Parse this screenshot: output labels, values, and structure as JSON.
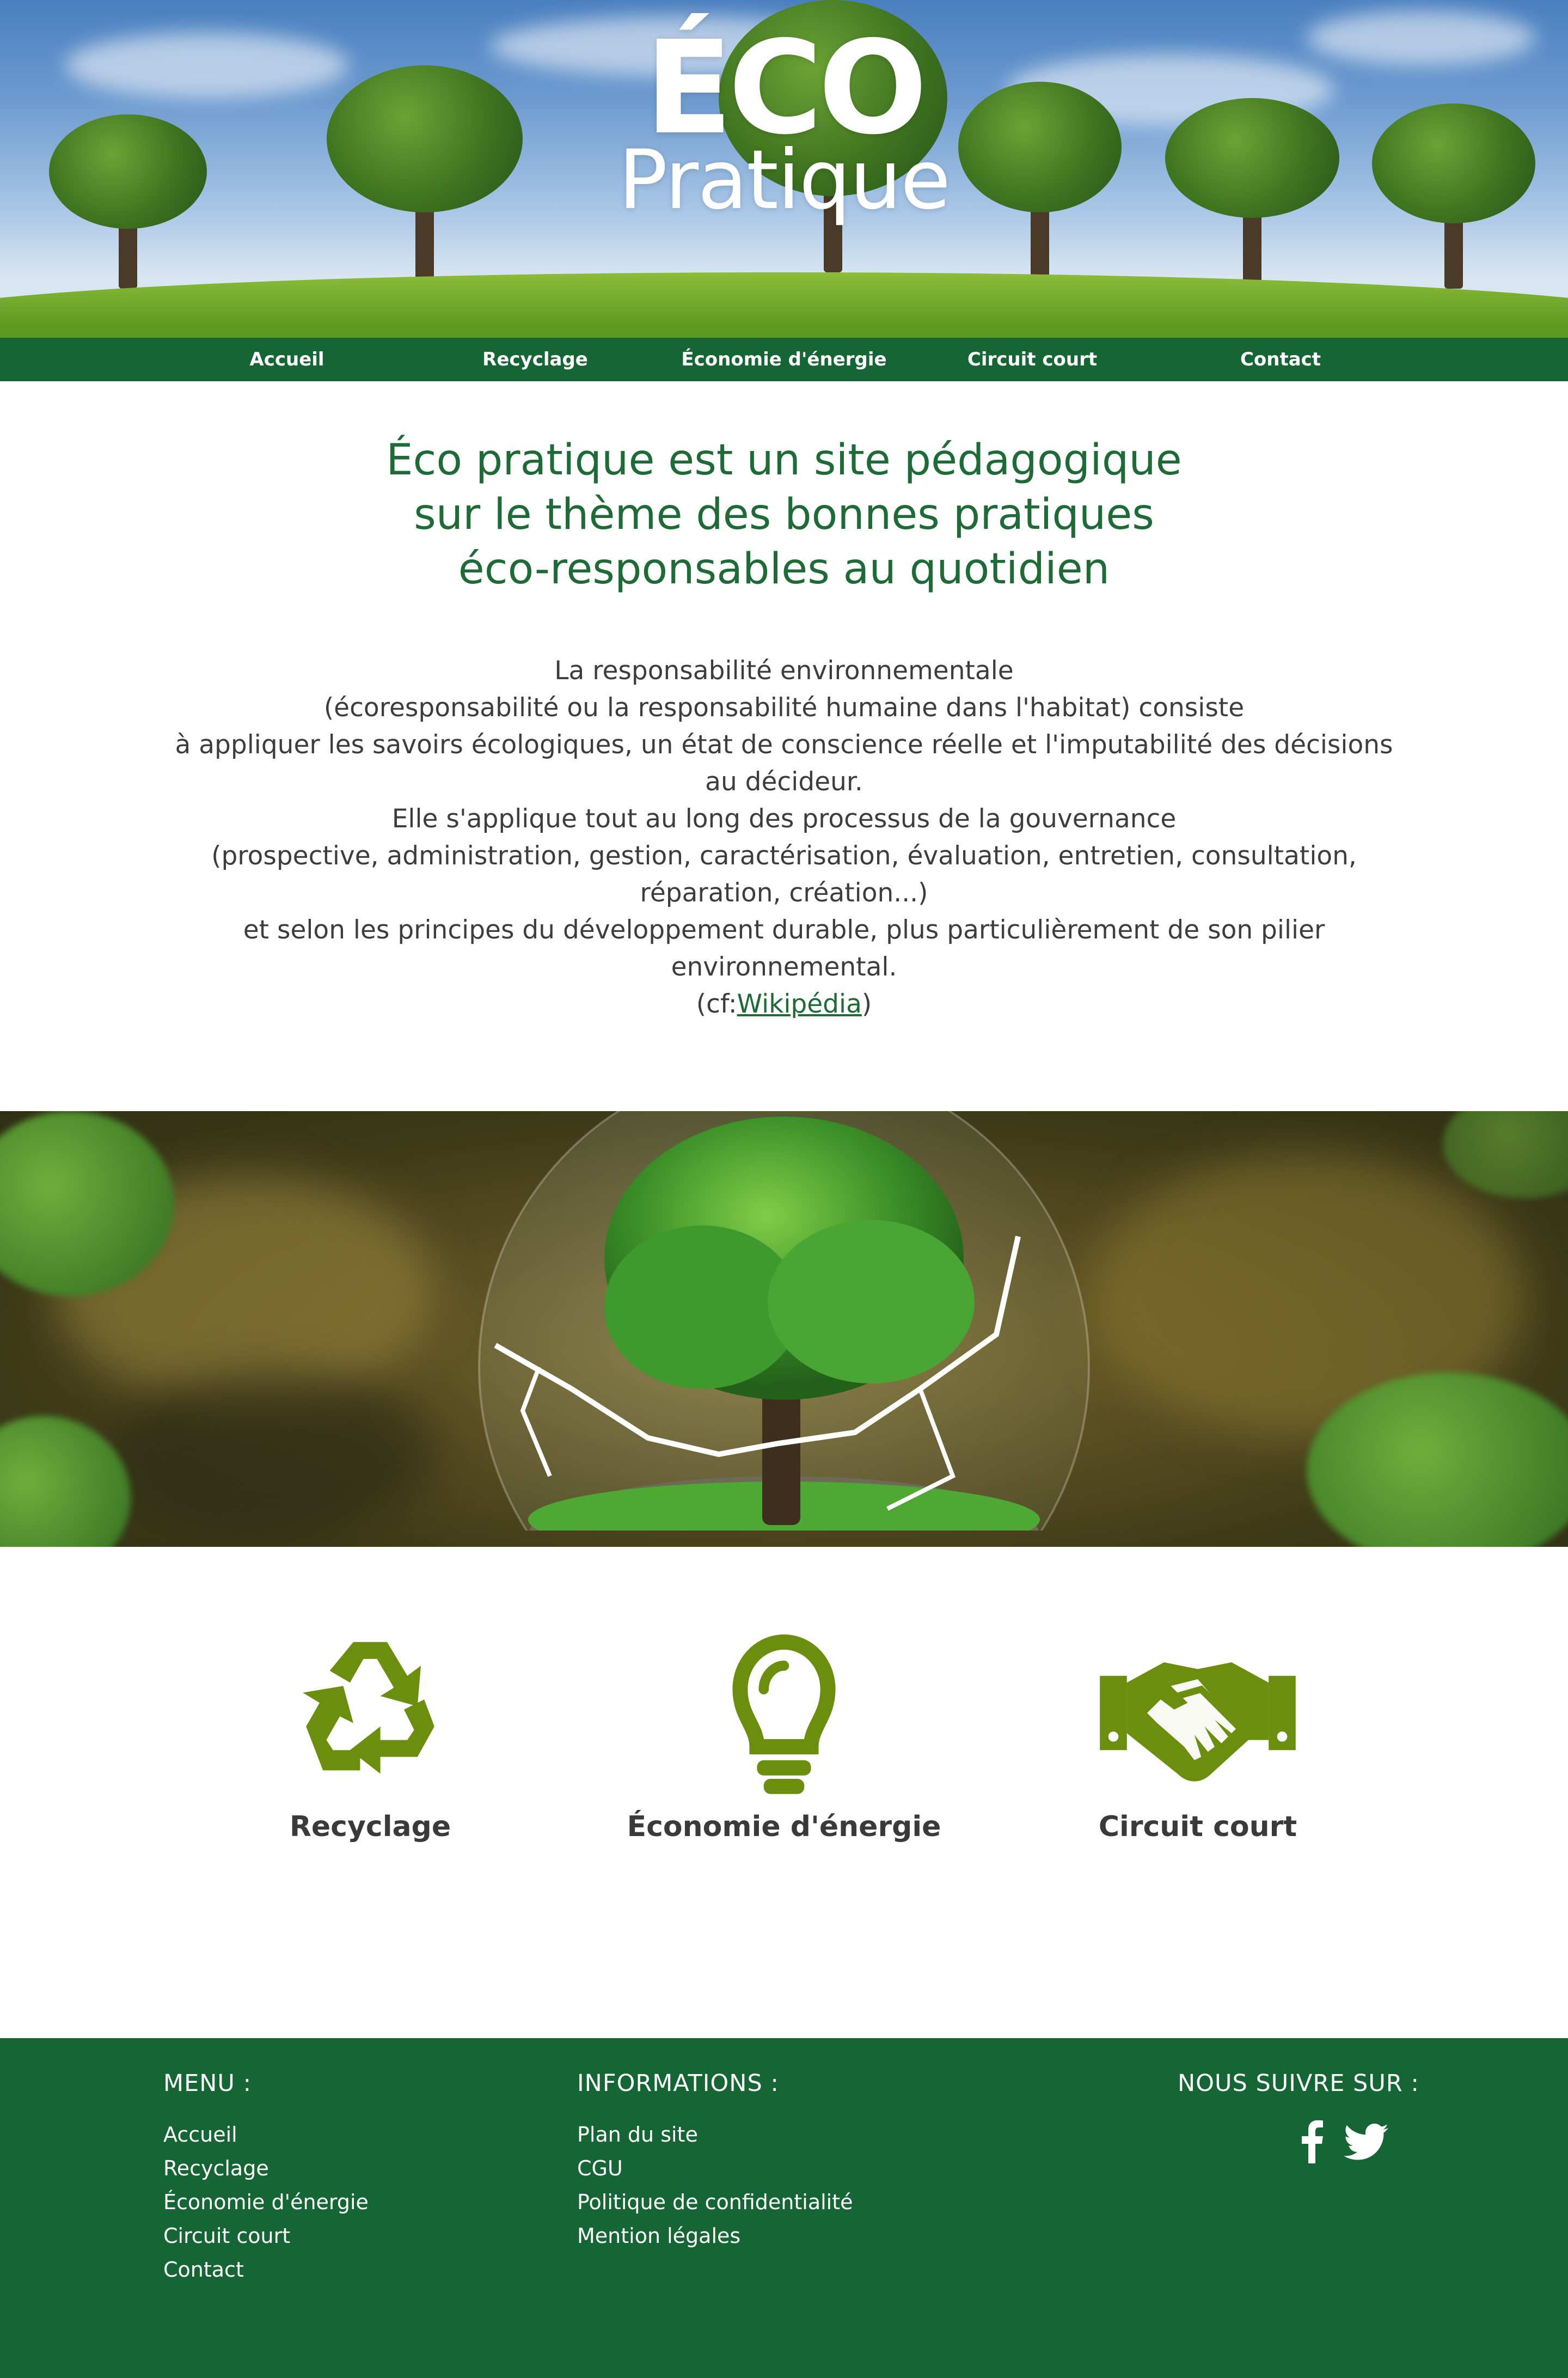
{
  "brand": {
    "logo_line1": "ÉCO",
    "logo_line2": "Pratique",
    "primary_color": "#166534",
    "accent_color": "#6b8e0f"
  },
  "nav": {
    "items": [
      {
        "label": "Accueil"
      },
      {
        "label": "Recyclage"
      },
      {
        "label": "Économie d'énergie"
      },
      {
        "label": "Circuit court"
      },
      {
        "label": "Contact"
      }
    ]
  },
  "intro": {
    "title_lines": [
      "Éco pratique est un site pédagogique",
      "sur le thème des bonnes pratiques",
      "éco-responsables au quotidien"
    ],
    "body_lines": [
      "La responsabilité environnementale",
      "(écoresponsabilité ou la responsabilité humaine dans l'habitat) consiste",
      "à appliquer les savoirs écologiques, un état de conscience réelle et l'imputabilité des décisions",
      "au décideur.",
      "Elle s'applique tout au long des processus de la gouvernance",
      "(prospective, administration, gestion, caractérisation, évaluation, entretien, consultation,",
      "réparation, création...)",
      "et selon les principes du développement durable, plus particulièrement de son pilier",
      "environnemental."
    ],
    "cite_prefix": "(cf:",
    "cite_link": "Wikipédia",
    "cite_suffix": ")"
  },
  "features": [
    {
      "label": "Recyclage",
      "icon": "recycle-icon"
    },
    {
      "label": "Économie d'énergie",
      "icon": "lightbulb-icon"
    },
    {
      "label": "Circuit court",
      "icon": "handshake-icon"
    }
  ],
  "footer": {
    "menu_title": "MENU :",
    "menu_items": [
      "Accueil",
      "Recyclage",
      "Économie d'énergie",
      "Circuit court",
      "Contact"
    ],
    "info_title": "INFORMATIONS :",
    "info_items": [
      "Plan du site",
      "CGU",
      "Politique de confidentialité",
      "Mention légales"
    ],
    "social_title": "NOUS SUIVRE SUR :",
    "social_icons": [
      "facebook-icon",
      "twitter-icon"
    ]
  }
}
